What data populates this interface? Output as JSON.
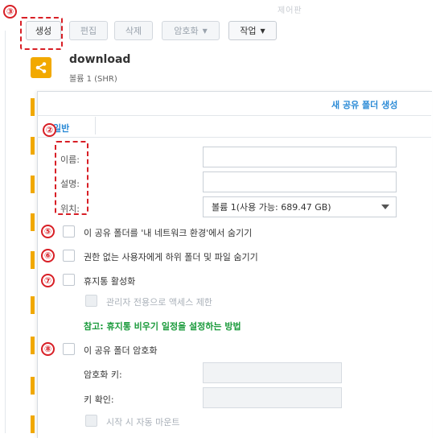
{
  "toolbar": {
    "faint_text": "제어판",
    "create": "생성",
    "edit": "편집",
    "delete": "삭제",
    "encrypt": "암호화",
    "action": "작업"
  },
  "markers": {
    "m3": "③",
    "m2": "②",
    "m5": "⑤",
    "m6": "⑥",
    "m7": "⑦",
    "m8": "⑧"
  },
  "share_item": {
    "name": "download",
    "volume": "볼륨 1 (SHR)"
  },
  "dialog": {
    "title": "새 공유 폴더 생성",
    "tab_general": "일반",
    "name_label": "이름:",
    "name_value": "",
    "desc_label": "설명:",
    "desc_value": "",
    "location_label": "위치:",
    "location_value": "볼륨 1(사용 가능: 689.47 GB)",
    "hide_network": "이 공유 폴더를 '내 네트워크 환경'에서 숨기기",
    "hide_unauth": "권한 없는 사용자에게 하위 폴더 및 파일 숨기기",
    "recycle_bin": "휴지통 활성화",
    "admin_only": "관리자 전용으로 액세스 제한",
    "note_link": "참고: 휴지통 비우기 일정을 설정하는 방법",
    "encrypt": "이 공유 폴더 암호화",
    "enc_key_label": "암호화 키:",
    "confirm_key_label": "키 확인:",
    "auto_mount": "시작 시 자동 마운트"
  },
  "colors": {
    "accent_blue": "#2a8ad6",
    "annotation_red": "#d81f26",
    "share_orange": "#f2a900",
    "note_green": "#1a9a3b"
  },
  "icons": {
    "share_item": "share-folder-icon",
    "location_dropdown": "chevron-down-icon"
  }
}
